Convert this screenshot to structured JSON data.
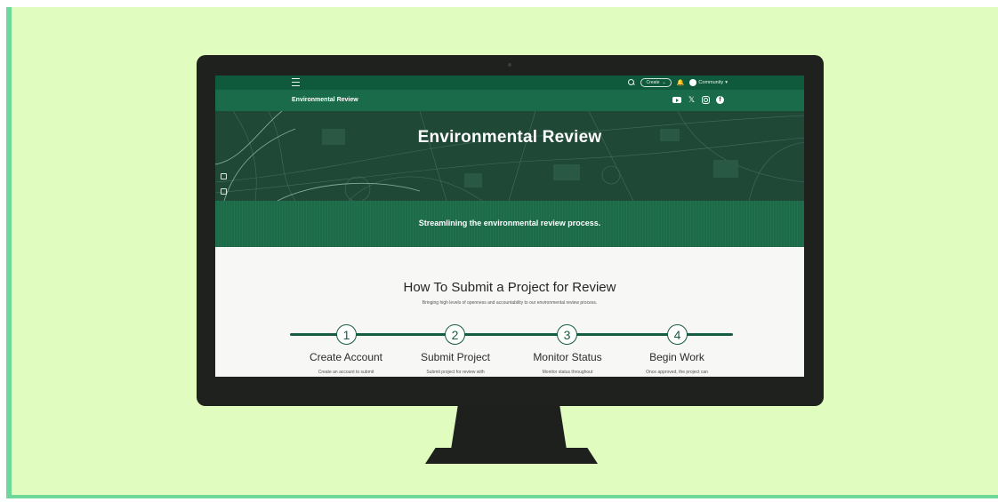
{
  "topbar": {
    "create_label": "Create",
    "create_chevron": "⌄",
    "community_label": "Community",
    "community_caret": "▾",
    "bell_glyph": "🔔"
  },
  "header": {
    "title": "Environmental Review",
    "socials": [
      {
        "name": "youtube-icon"
      },
      {
        "name": "x-icon",
        "glyph": "𝕏"
      },
      {
        "name": "instagram-icon"
      },
      {
        "name": "facebook-icon",
        "glyph": "f"
      }
    ]
  },
  "hero": {
    "title": "Environmental Review",
    "tagline": "Streamlining the environmental review process."
  },
  "section": {
    "title": "How To Submit a Project for Review",
    "subtitle": "Bringing high levels of openness and accountability to our environmental review process."
  },
  "steps": [
    {
      "number": "1",
      "title": "Create Account",
      "desc": "Create an account to submit"
    },
    {
      "number": "2",
      "title": "Submit Project",
      "desc": "Submit project for review with"
    },
    {
      "number": "3",
      "title": "Monitor Status",
      "desc": "Monitor status throughout"
    },
    {
      "number": "4",
      "title": "Begin Work",
      "desc": "Once approved, the project can"
    }
  ],
  "colors": {
    "backdrop": "#e0fcbf",
    "accent_border": "#6fd79a",
    "brand_dark": "#0f5a3c",
    "brand": "#1a6b49"
  }
}
